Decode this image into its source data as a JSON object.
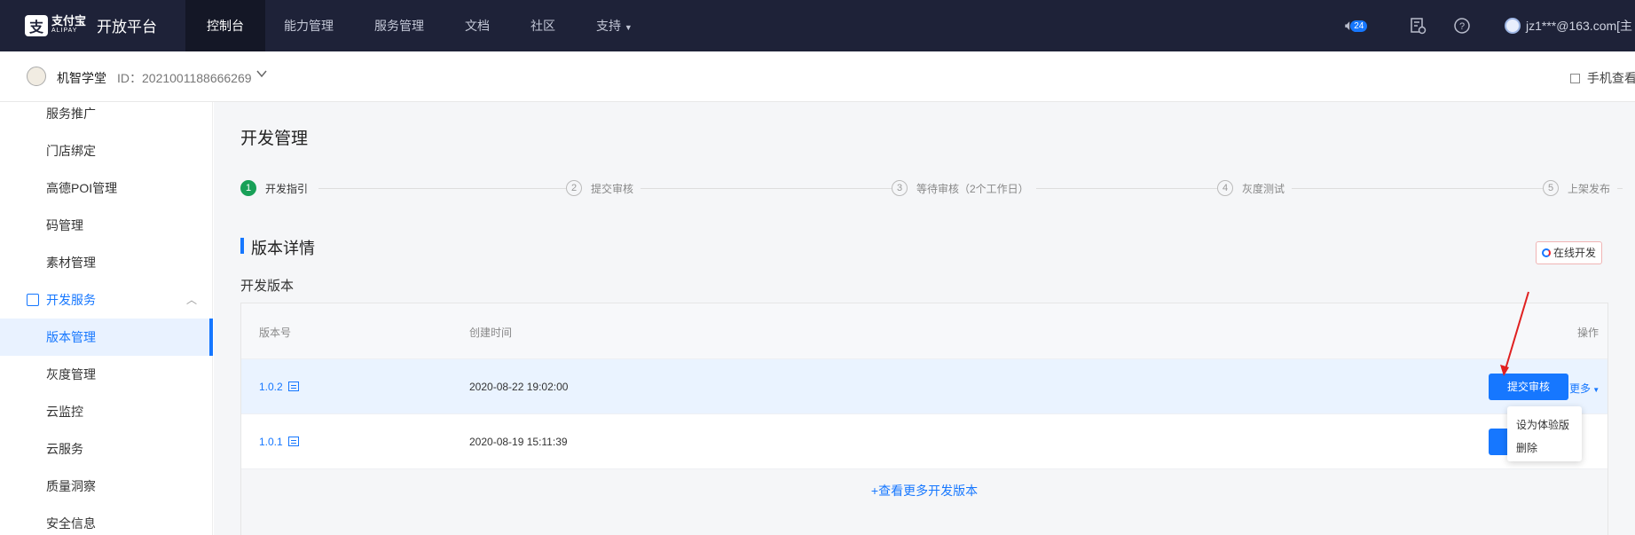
{
  "topnav": {
    "logo_cn": "支付宝",
    "logo_en": "ALIPAY",
    "platform": "开放平台",
    "items": [
      "控制台",
      "能力管理",
      "服务管理",
      "文档",
      "社区",
      "支持"
    ],
    "badge_count": "24",
    "user": "jz1***@163.com[主",
    "colors": {
      "bg": "#1e2238",
      "active_bg": "#141726"
    }
  },
  "app": {
    "name": "机智学堂",
    "id": "ID：2021001188666269",
    "mobile_view": "手机查看"
  },
  "sidebar": {
    "items_top": [
      "服务推广",
      "门店绑定",
      "高德POI管理",
      "码管理",
      "素材管理"
    ],
    "group": "开发服务",
    "items_group": [
      "版本管理",
      "灰度管理",
      "云监控",
      "云服务",
      "质量洞察",
      "安全信息"
    ]
  },
  "main": {
    "title": "开发管理",
    "steps": [
      {
        "num": "1",
        "label": "开发指引"
      },
      {
        "num": "2",
        "label": "提交审核"
      },
      {
        "num": "3",
        "label": "等待审核（2个工作日）"
      },
      {
        "num": "4",
        "label": "灰度测试"
      },
      {
        "num": "5",
        "label": "上架发布"
      }
    ],
    "section_title": "版本详情",
    "online_dev": "在线开发",
    "sub_title": "开发版本",
    "table": {
      "headers": [
        "版本号",
        "创建时间",
        "操作"
      ],
      "rows": [
        {
          "version": "1.0.2",
          "created": "2020-08-22 19:02:00",
          "action": "提交审核",
          "more": "更多"
        },
        {
          "version": "1.0.1",
          "created": "2020-08-19 15:11:39",
          "action": "提交审核"
        }
      ],
      "view_more": "+查看更多开发版本"
    },
    "dropdown": [
      "设为体验版",
      "删除"
    ]
  },
  "accent": "#1677ff"
}
